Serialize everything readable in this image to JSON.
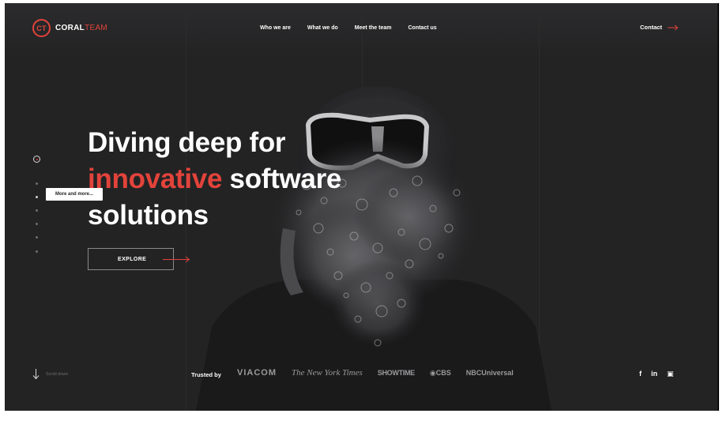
{
  "brand": {
    "monogram": "CT",
    "name_primary": "CORAL",
    "name_accent": "TEAM",
    "accent_color": "#e2433b"
  },
  "nav": {
    "items": [
      {
        "label": "Who we are"
      },
      {
        "label": "What we do"
      },
      {
        "label": "Meet the team"
      },
      {
        "label": "Contact us"
      }
    ],
    "contact_label": "Contact"
  },
  "pager": {
    "tooltip": "More and more..."
  },
  "hero": {
    "line1": "Diving deep for",
    "accent_word": "innovative",
    "line2_rest": " software",
    "line3": "solutions",
    "cta_label": "EXPLORE"
  },
  "footer": {
    "scroll_label": "Scroll down",
    "trusted_label": "Trusted by",
    "brands": [
      "VIACOM",
      "The New York Times",
      "SHOWTIME",
      "◉CBS",
      "NBCUniversal"
    ],
    "social": [
      "f",
      "in",
      "▣"
    ]
  },
  "icons": {
    "arrow": "arrow-right-icon",
    "scroll": "arrow-down-icon",
    "social": [
      "facebook-icon",
      "linkedin-icon",
      "instagram-icon"
    ]
  },
  "colors": {
    "background": "#232324",
    "text": "#ffffff",
    "muted": "#9a9a9c"
  }
}
